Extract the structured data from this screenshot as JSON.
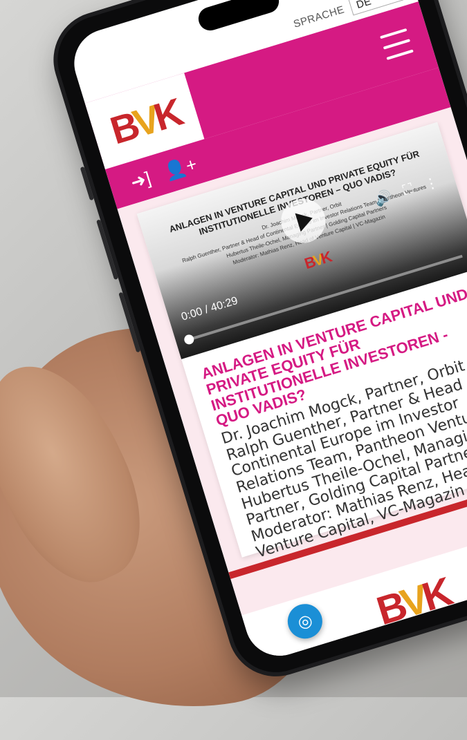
{
  "language": {
    "label": "SPRACHE",
    "selected": "DE"
  },
  "header": {
    "logo": {
      "b": "B",
      "v": "V",
      "k": "K"
    }
  },
  "subbar": {
    "login_icon": "login-icon",
    "register_icon": "add-user-icon"
  },
  "video": {
    "title": "ANLAGEN IN VENTURE CAPITAL UND PRIVATE EQUITY FÜR INSTITUTIONELLE INVESTOREN – QUO VADIS?",
    "lines": [
      "Dr. Joachim Mogck, Partner, Orbit",
      "Ralph Guenther, Partner & Head of Continental Europe im Investor Relations Team | Pantheon Ventures",
      "Hubertus Theile-Ochel, Managing Partner | Golding Capital Partners",
      "Moderator: Mathias Renz, Head of Venture Capital | VC-Magazin"
    ],
    "time": "0:00 / 40:29",
    "progress": 0
  },
  "card": {
    "title": "ANLAGEN IN VENTURE CAPITAL UND PRIVATE EQUITY FÜR INSTITUTIONELLE INVESTOREN - QUO VADIS?",
    "speakers": "Dr. Joachim Mogck, Partner, Orbit Ralph Guenther, Partner & Head of Continental Europe im Investor Relations Team, Pantheon Ventures Hubertus Theile-Ochel, Managing Partner, Golding Capital Partners Moderator: Mathias Renz, Head of Venture Capital, VC-Magazin"
  },
  "colors": {
    "magenta": "#d51a83",
    "red": "#c8262c",
    "gold": "#e8a31e",
    "fab_blue": "#1b8fd6"
  }
}
